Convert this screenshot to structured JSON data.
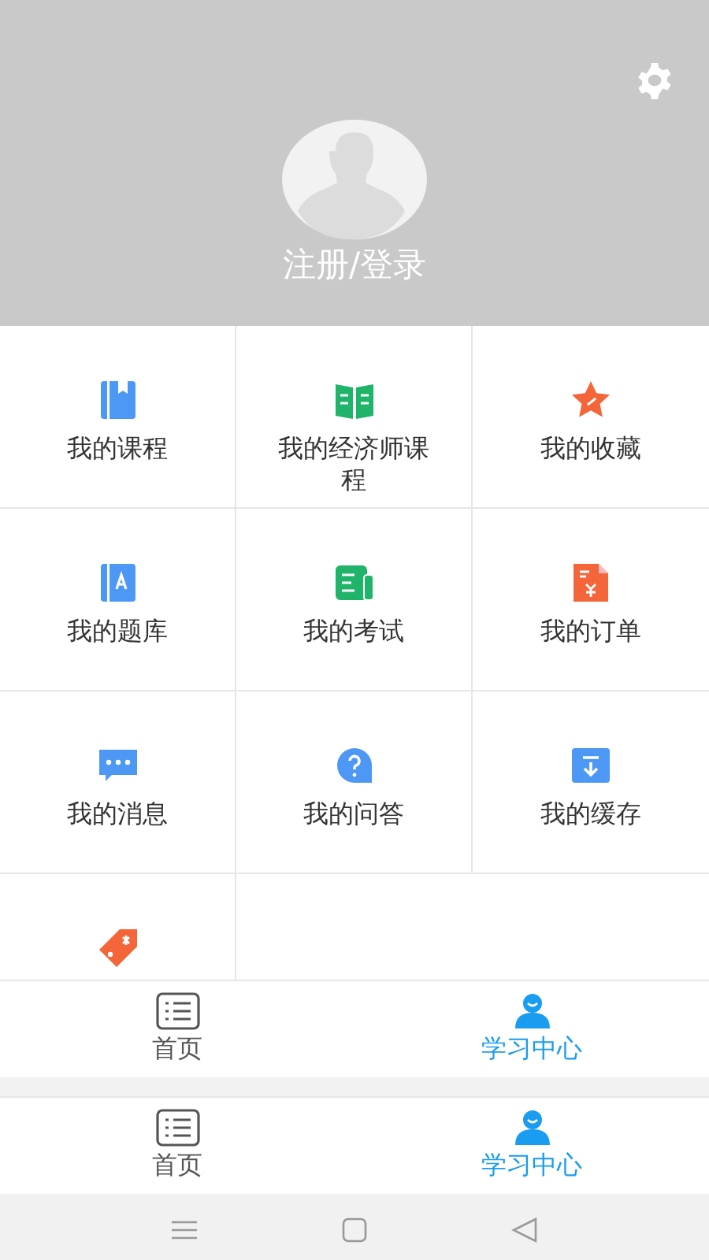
{
  "header": {
    "login_label": "注册/登录"
  },
  "menu": [
    {
      "kind": "book",
      "label": "我的课程"
    },
    {
      "kind": "open-book",
      "label": "我的经济师课程"
    },
    {
      "kind": "star",
      "label": "我的收藏"
    },
    {
      "kind": "letter-book",
      "label": "我的题库"
    },
    {
      "kind": "exam",
      "label": "我的考试"
    },
    {
      "kind": "order",
      "label": "我的订单"
    },
    {
      "kind": "chat",
      "label": "我的消息"
    },
    {
      "kind": "question",
      "label": "我的问答"
    },
    {
      "kind": "download",
      "label": "我的缓存"
    },
    {
      "kind": "tag"
    }
  ],
  "nav_bars": [
    {
      "items": [
        {
          "kind": "list",
          "label": "首页",
          "selected": false
        },
        {
          "kind": "person",
          "label": "学习中心",
          "selected": true
        }
      ]
    },
    {
      "items": [
        {
          "kind": "list",
          "label": "首页",
          "selected": false
        },
        {
          "kind": "person",
          "label": "学习中心",
          "selected": true
        }
      ]
    }
  ]
}
